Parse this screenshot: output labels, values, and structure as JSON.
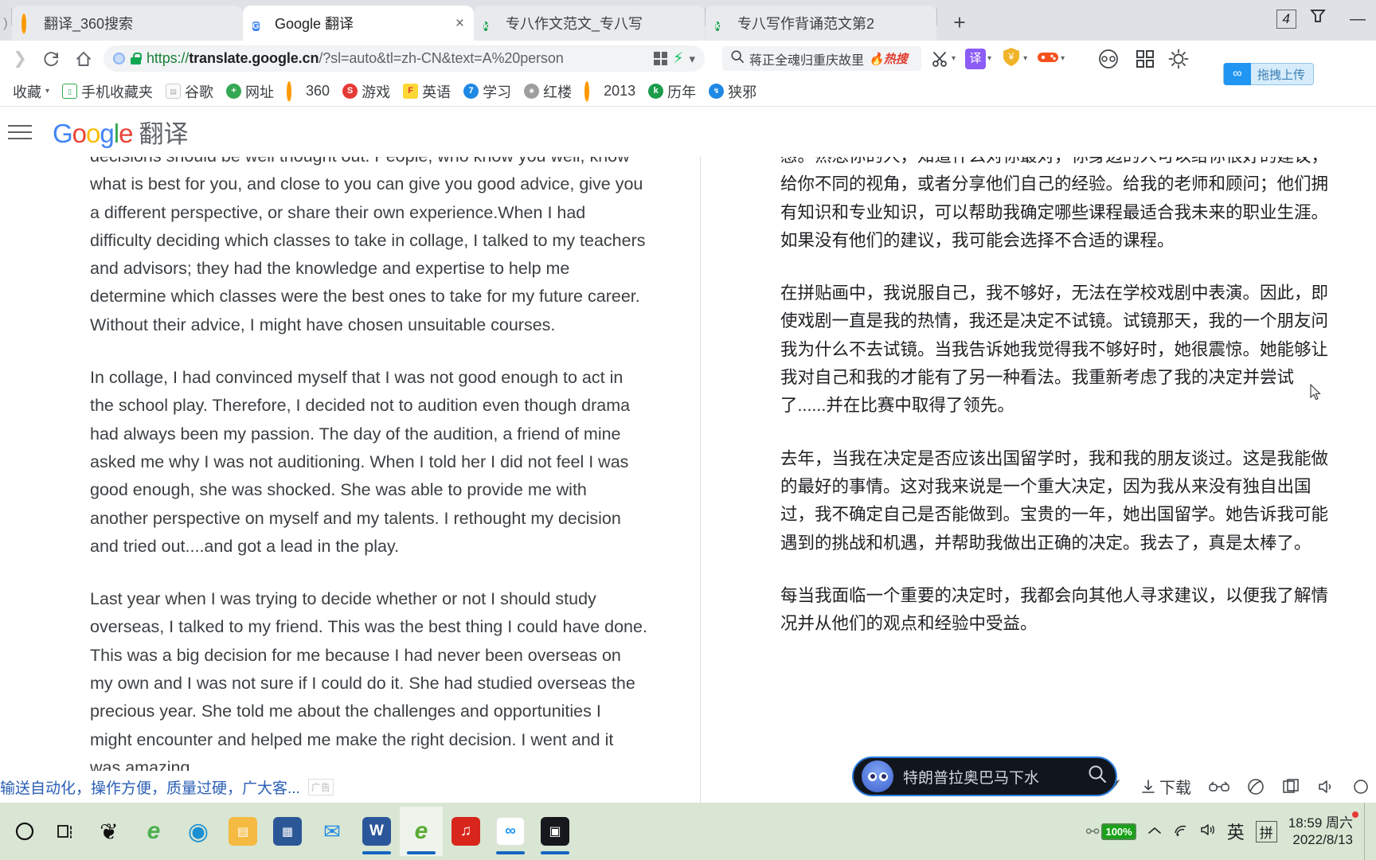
{
  "browser": {
    "tabs": [
      {
        "title": "翻译_360搜索",
        "icon": "360-favicon",
        "active": false
      },
      {
        "title": "Google 翻译",
        "icon": "google-translate-favicon",
        "active": true
      },
      {
        "title": "专八作文范文_专八写",
        "icon": "kingsoft-favicon",
        "active": false
      },
      {
        "title": "专八写作背诵范文第2",
        "icon": "kingsoft-favicon",
        "active": false
      }
    ],
    "new_tab_label": "+",
    "tab_close_label": "×",
    "window_controls": {
      "tab_count": "4",
      "restore_label": "▽",
      "minimize_label": "—"
    },
    "nav": {
      "forward_icon": "forward-arrow-icon",
      "reload_icon": "reload-icon",
      "home_icon": "home-icon"
    },
    "omnibox": {
      "scheme": "https://",
      "host": "translate.google.cn",
      "path": "/?sl=auto&tl=zh-CN&text=A%20person",
      "full_url": "https://translate.google.cn/?sl=auto&tl=zh-CN&text=A%20person",
      "qr_icon": "qr-code-icon",
      "bolt_icon": "lightning-bolt-icon",
      "chevron_icon": "chevron-down-icon"
    },
    "search": {
      "placeholder": "蒋正全魂归重庆故里",
      "hot_label": "热搜",
      "search_icon": "search-icon"
    },
    "toolbar_right": [
      {
        "name": "scissors-tool",
        "glyph": "✂",
        "color": "#3c4043",
        "kind": "glyph"
      },
      {
        "name": "translate-tool",
        "glyph": "译",
        "color": "#8b5cf6",
        "kind": "square"
      },
      {
        "name": "coupon-tool",
        "glyph": "¥",
        "color": "#f0b429",
        "kind": "shield"
      },
      {
        "name": "game-tool",
        "glyph": "🎮",
        "color": "#f4511e",
        "kind": "glyph"
      },
      {
        "name": "baidu-netdisk-tool",
        "glyph": "∞",
        "color": "#2196f3",
        "kind": "square"
      },
      {
        "name": "apps-grid-tool",
        "glyph": "▤",
        "color": "#3c4043",
        "kind": "glyph"
      },
      {
        "name": "theme-tool",
        "glyph": "☀",
        "color": "#3c4043",
        "kind": "glyph"
      }
    ],
    "drag_upload_tip": "拖拽上传",
    "bookmarks": [
      {
        "label": "收藏",
        "icon": "star-folder-icon",
        "color": ""
      },
      {
        "label": "手机收藏夹",
        "icon": "phone-icon",
        "color": "#34a853"
      },
      {
        "label": "谷歌",
        "icon": "page-icon",
        "color": "#cccccc"
      },
      {
        "label": "网址",
        "icon": "plus-circle-icon",
        "color": "#34a853"
      },
      {
        "label": "360",
        "icon": "360-icon",
        "color": "#f90"
      },
      {
        "label": "游戏",
        "icon": "game-icon",
        "color": "#e53935"
      },
      {
        "label": "英语",
        "icon": "english-icon",
        "color": "#fdd835"
      },
      {
        "label": "学习",
        "icon": "study-icon",
        "color": "#1e88e5"
      },
      {
        "label": "红楼",
        "icon": "hongluo-icon",
        "color": "#9e9e9e"
      },
      {
        "label": "2013",
        "icon": "360-icon",
        "color": "#f90"
      },
      {
        "label": "历年",
        "icon": "kingsoft-icon",
        "color": "#1a9c4b"
      },
      {
        "label": "狭邪",
        "icon": "link-icon",
        "color": "#1e88e5"
      }
    ],
    "bookmark_caret": "▾"
  },
  "gt": {
    "menu_icon": "hamburger-menu-icon",
    "logo": {
      "g1": "G",
      "o1": "o",
      "o2": "o",
      "g2": "g",
      "l": "l",
      "e": "e"
    },
    "product_word": "翻译",
    "source_text": [
      "decisions should be well thought out. People, who know you well, know what is best for you, and close to you can give you good advice, give you a different perspective, or share their own experience.When I had difficulty deciding which classes to take in collage, I talked to my teachers and advisors; they had the knowledge and expertise to help me determine which classes were the best ones to take for my future career. Without their advice, I might have chosen unsuitable courses.",
      "In collage, I had convinced myself that I was not good enough to act in the school play. Therefore, I decided not to audition even though drama had always been my passion. The day of the audition, a friend of mine asked me why I was not auditioning. When I told her I did not feel I was good enough, she was shocked. She was able to provide me with another perspective on myself and my talents. I rethought my decision and tried out....and got a lead in the play.",
      "Last year when I was trying to decide whether or not I should study overseas, I talked to my friend. This was the best thing I could have done. This was a big decision for me because I had never been overseas on my own and I was not sure if I could do it. She had studied overseas the precious year. She told me about the challenges and opportunities I might encounter and helped me make the right decision. I went and it was amazing."
    ],
    "target_text": [
      "感。熟悉你的人，知道什么对你最对，你身边的人可以给你很好的建议，给你不同的视角，或者分享他们自己的经验。给我的老师和顾问；他们拥有知识和专业知识，可以帮助我确定哪些课程最适合我未来的职业生涯。如果没有他们的建议，我可能会选择不合适的课程。",
      "在拼贴画中，我说服自己，我不够好，无法在学校戏剧中表演。因此，即使戏剧一直是我的热情，我还是决定不试镜。试镜那天，我的一个朋友问我为什么不去试镜。当我告诉她我觉得我不够好时，她很震惊。她能够让我对自己和我的才能有了另一种看法。我重新考虑了我的决定并尝试了......并在比赛中取得了领先。",
      "去年，当我在决定是否应该出国留学时，我和我的朋友谈过。这是我能做的最好的事情。这对我来说是一个重大决定，因为我从来没有独自出国过，我不确定自己是否能做到。宝贵的一年，她出国留学。她告诉我可能遇到的挑战和机遇，并帮助我做出正确的决定。我去了，真是太棒了。",
      "每当我面临一个重要的决定时，我都会向其他人寻求建议，以便我了解情况并从他们的观点和经验中受益。"
    ]
  },
  "ad": {
    "text": "输送自动化，操作方便，质量过硬，广大客...",
    "tag": "广告"
  },
  "float_search": {
    "query": "特朗普拉奥巴马下水",
    "avatar_icon": "bird-avatar-icon",
    "search_icon": "search-icon"
  },
  "bottom_tools": [
    {
      "label": "",
      "icon": "rocket-icon"
    },
    {
      "label": "下载",
      "icon": "download-icon"
    },
    {
      "label": "",
      "icon": "glasses-icon"
    },
    {
      "label": "",
      "icon": "shield-leaf-icon"
    },
    {
      "label": "",
      "icon": "window-split-icon"
    },
    {
      "label": "",
      "icon": "volume-icon"
    },
    {
      "label": "",
      "icon": "circle-icon"
    }
  ],
  "taskbar": {
    "start_icon": "start-circle-icon",
    "taskview_icon": "task-view-icon",
    "apps": [
      {
        "name": "sogou-input",
        "glyph": "S",
        "color": "#111111",
        "running": false,
        "active": false
      },
      {
        "name": "internet-explorer",
        "glyph": "e",
        "color": "#4cb050",
        "running": false,
        "active": false
      },
      {
        "name": "microsoft-edge",
        "glyph": "e",
        "color": "#1a8fd1",
        "running": false,
        "active": false
      },
      {
        "name": "file-explorer",
        "glyph": "▭",
        "color": "#f5ba41",
        "running": false,
        "active": false
      },
      {
        "name": "microsoft-store",
        "glyph": "▦",
        "color": "#2b5797",
        "running": false,
        "active": false
      },
      {
        "name": "mail",
        "glyph": "✉",
        "color": "#1e88e5",
        "running": false,
        "active": false
      },
      {
        "name": "microsoft-word",
        "glyph": "W",
        "color": "#2b579a",
        "running": true,
        "active": false
      },
      {
        "name": "360-browser",
        "glyph": "e",
        "color": "#5aab33",
        "running": true,
        "active": true
      },
      {
        "name": "netease-music",
        "glyph": "♪",
        "color": "#d8261c",
        "running": false,
        "active": false
      },
      {
        "name": "baidu-netdisk",
        "glyph": "∞",
        "color": "#2196f3",
        "running": true,
        "active": false
      },
      {
        "name": "screen-recorder",
        "glyph": "▣",
        "color": "#16181d",
        "running": true,
        "active": false
      }
    ],
    "tray": {
      "battery_percent": "100%",
      "battery_icon": "battery-charging-icon",
      "chevron_icon": "chevron-up-icon",
      "wifi_icon": "wifi-icon",
      "volume_icon": "volume-icon",
      "ime_lang": "英",
      "ime_mode": "拼",
      "time": "18:59 周六",
      "date": "2022/8/13"
    }
  }
}
